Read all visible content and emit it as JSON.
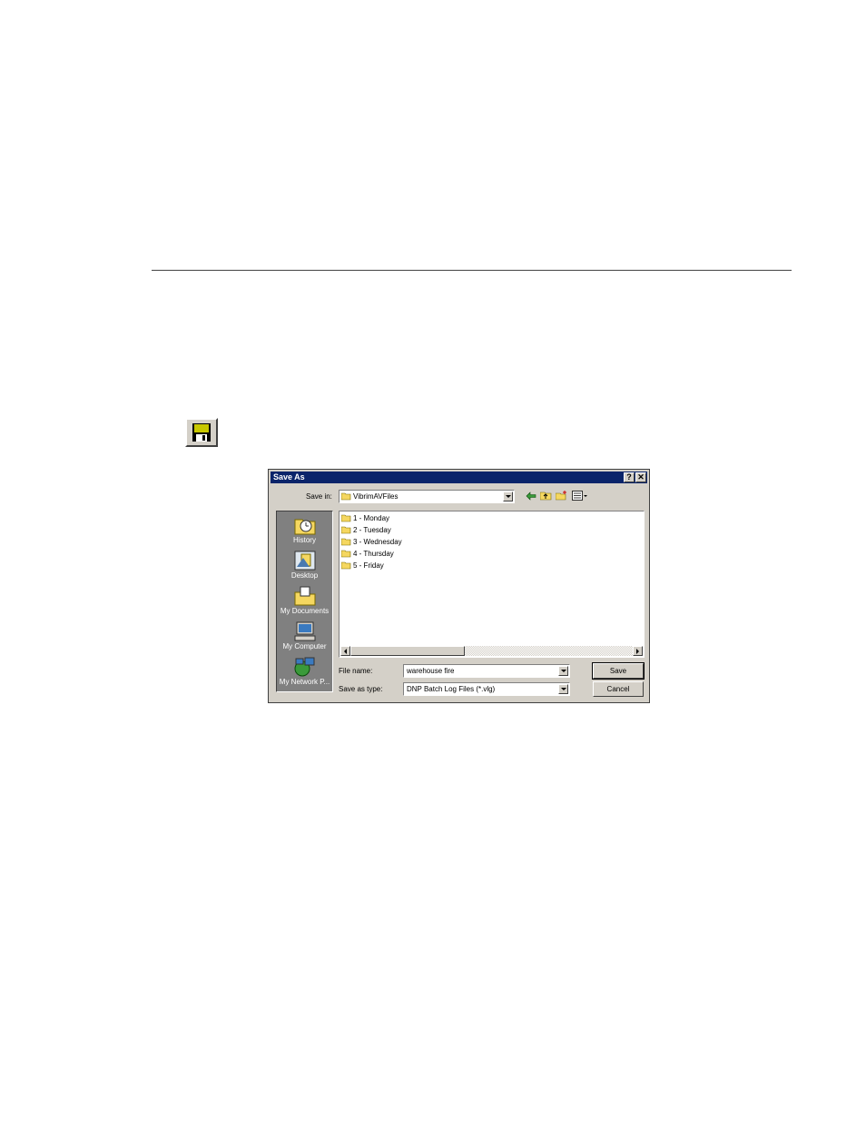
{
  "dialog": {
    "title": "Save As",
    "help_glyph": "?",
    "close_glyph": "✕",
    "save_in_label": "Save in:",
    "save_in_label_hot": "i",
    "current_folder": "VibrimAVFiles",
    "places": [
      {
        "label": "History",
        "icon": "history-icon"
      },
      {
        "label": "Desktop",
        "icon": "desktop-icon"
      },
      {
        "label": "My Documents",
        "icon": "my-documents-icon"
      },
      {
        "label": "My Computer",
        "icon": "my-computer-icon"
      },
      {
        "label": "My Network P...",
        "icon": "my-network-places-icon"
      }
    ],
    "files": [
      {
        "name": "1 - Monday",
        "icon": "folder-icon"
      },
      {
        "name": "2 - Tuesday",
        "icon": "folder-icon"
      },
      {
        "name": "3 - Wednesday",
        "icon": "folder-icon"
      },
      {
        "name": "4 - Thursday",
        "icon": "folder-icon"
      },
      {
        "name": "5 - Friday",
        "icon": "folder-icon"
      }
    ],
    "file_name_label": "File name:",
    "file_name_value": "warehouse fire",
    "save_type_label": "Save as type:",
    "save_type_value": "DNP Batch Log Files (*.vlg)",
    "save_button": "Save",
    "cancel_button": "Cancel"
  },
  "colors": {
    "title_bar": "#0a246a",
    "face": "#d4d0c8",
    "places_bar": "#808080",
    "folder": "#f5d760"
  }
}
